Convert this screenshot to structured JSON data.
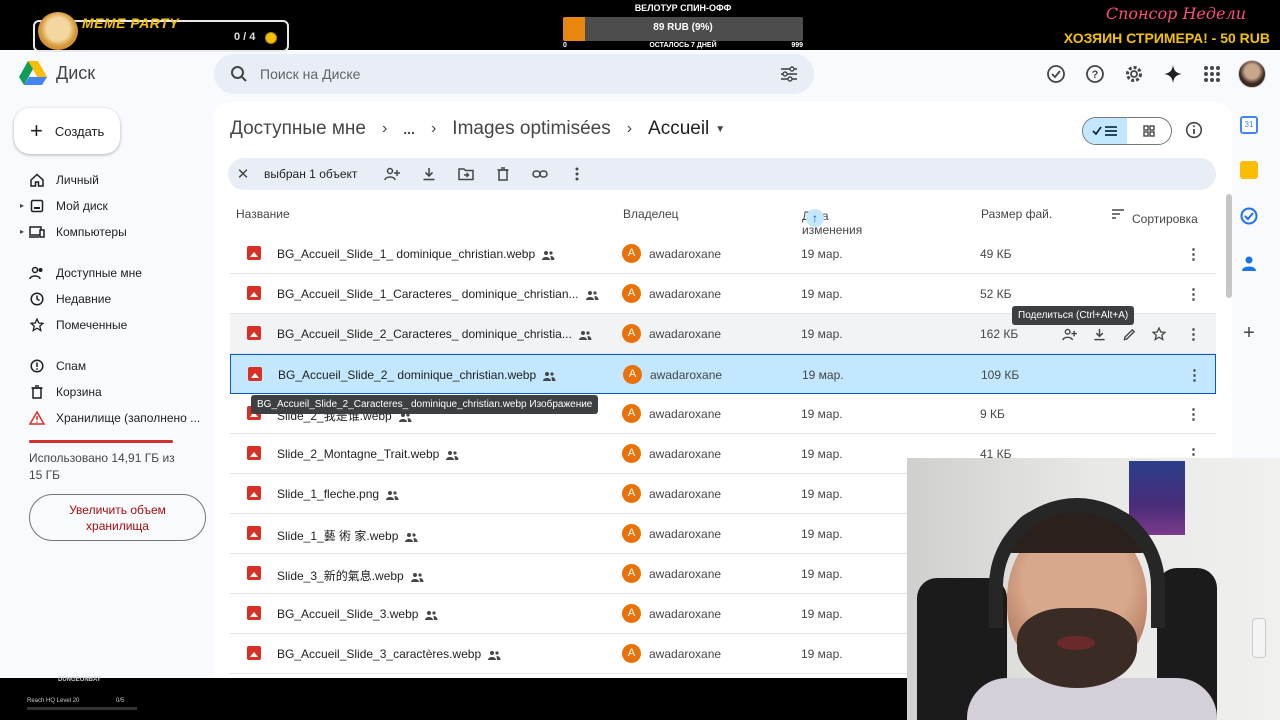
{
  "overlay": {
    "meme_title": "MEME PARTY",
    "meme_count": "0 / 4",
    "goal_title": "ВЕЛОТУР СПИН-ОФФ",
    "goal_text": "89 RUB (9%)",
    "goal_progress_percent": 9,
    "goal_min": "0",
    "goal_remaining": "ОСТАЛОСЬ 7 ДНЕЙ",
    "goal_max": "999",
    "sponsor_title": "Спонсор Недели",
    "sponsor_name": "ХОЗЯИН СТРИМЕРА! - 50 RUB",
    "bottom_logo": "DUNGEONBAY",
    "bottom_info": "Reach HQ Level 20",
    "bottom_count": "0/5"
  },
  "drive": {
    "app_name": "Диск",
    "search_placeholder": "Поиск на Диске",
    "create_label": "Создать",
    "nav": [
      {
        "label": "Личный",
        "icon": "home-icon"
      },
      {
        "label": "Мой диск",
        "icon": "drive-icon"
      },
      {
        "label": "Компьютеры",
        "icon": "computer-icon"
      },
      {
        "label": "Доступные мне",
        "icon": "shared-icon"
      },
      {
        "label": "Недавние",
        "icon": "clock-icon"
      },
      {
        "label": "Помеченные",
        "icon": "star-icon"
      },
      {
        "label": "Спам",
        "icon": "spam-icon"
      },
      {
        "label": "Корзина",
        "icon": "trash-icon"
      },
      {
        "label": "Хранилище (заполнено ...",
        "icon": "warning-icon"
      }
    ],
    "storage_text": "Использовано 14,91 ГБ из 15 ГБ",
    "upgrade_label": "Увеличить объем хранилища",
    "breadcrumb": [
      "Доступные мне",
      "...",
      "Images optimisées",
      "Accueil"
    ],
    "selection_text": "выбран 1 объект",
    "columns": {
      "name": "Название",
      "owner": "Владелец",
      "modified": "Дата изменения",
      "size": "Размер фай.",
      "sort": "Сортировка"
    },
    "rows": [
      {
        "name": "BG_Accueil_Slide_1_ dominique_christian.webp",
        "owner": "awadaroxane",
        "date": "19 мар.",
        "size": "49 КБ"
      },
      {
        "name": "BG_Accueil_Slide_1_Caracteres_ dominique_christian...",
        "owner": "awadaroxane",
        "date": "19 мар.",
        "size": "52 КБ"
      },
      {
        "name": "BG_Accueil_Slide_2_Caracteres_ dominique_christia...",
        "owner": "awadaroxane",
        "date": "19 мар.",
        "size": "162 КБ"
      },
      {
        "name": "BG_Accueil_Slide_2_ dominique_christian.webp",
        "owner": "awadaroxane",
        "date": "19 мар.",
        "size": "109 КБ"
      },
      {
        "name": "Slide_2_我是谁.webp",
        "owner": "awadaroxane",
        "date": "19 мар.",
        "size": "9 КБ"
      },
      {
        "name": "Slide_2_Montagne_Trait.webp",
        "owner": "awadaroxane",
        "date": "19 мар.",
        "size": "41 КБ"
      },
      {
        "name": "Slide_1_fleche.png",
        "owner": "awadaroxane",
        "date": "19 мар.",
        "size": ""
      },
      {
        "name": "Slide_1_藝 術 家.webp",
        "owner": "awadaroxane",
        "date": "19 мар.",
        "size": ""
      },
      {
        "name": "Slide_3_新的氣息.webp",
        "owner": "awadaroxane",
        "date": "19 мар.",
        "size": ""
      },
      {
        "name": "BG_Accueil_Slide_3.webp",
        "owner": "awadaroxane",
        "date": "19 мар.",
        "size": ""
      },
      {
        "name": "BG_Accueil_Slide_3_caractères.webp",
        "owner": "awadaroxane",
        "date": "19 мар.",
        "size": ""
      }
    ],
    "owner_initial": "A",
    "tooltip_share": "Поделиться (Ctrl+Alt+A)",
    "tooltip_file": "BG_Accueil_Slide_2_Caracteres_ dominique_christian.webp Изображение"
  }
}
